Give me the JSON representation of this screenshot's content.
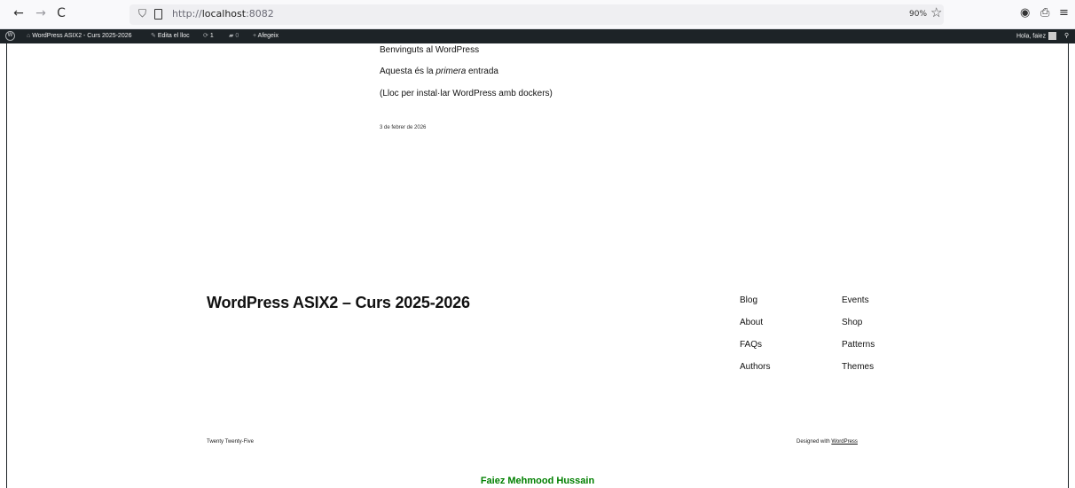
{
  "browser": {
    "back": "←",
    "forward": "→",
    "reload": "C",
    "url_prefix": "http://",
    "url_host": "localhost",
    "url_port": ":8082",
    "zoom": "90%"
  },
  "admin_bar": {
    "site_name": "WordPress ASIX2 - Curs 2025-2026",
    "edit_site": "Edita el lloc",
    "updates_count": "1",
    "comments_count": "0",
    "add_new": "Afegeix",
    "greeting": "Hola, faiez"
  },
  "post": {
    "title_line": "Benvinguts al WordPress",
    "line2_before": "Aquesta és la ",
    "line2_em": "primera",
    "line2_after": " entrada",
    "line3": "(Lloc per instal·lar WordPress amb dockers)",
    "date": "3 de febrer de 2026"
  },
  "footer": {
    "site_title": "WordPress ASIX2 – Curs 2025-2026",
    "nav_col1": [
      "Blog",
      "About",
      "FAQs",
      "Authors"
    ],
    "nav_col2": [
      "Events",
      "Shop",
      "Patterns",
      "Themes"
    ],
    "theme_name": "Twenty Twenty-Five",
    "designed_with": "Designed with ",
    "designed_link": "WordPress",
    "credit": "Faiez Mehmood Hussain"
  }
}
